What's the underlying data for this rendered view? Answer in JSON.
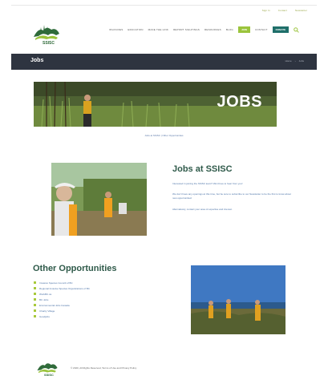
{
  "utility_links": [
    "Sign In",
    "Contact",
    "Newsletter"
  ],
  "brand": {
    "logo_text": "SSISC",
    "accent": "#9bc43c",
    "dark": "#2e3440",
    "teal": "#1f6f6a"
  },
  "nav": {
    "items": [
      "Invasives",
      "Education",
      "Make the Link",
      "Report Sightings",
      "Resources",
      "Blog"
    ],
    "join_label": "Join",
    "contact_label": "Contact",
    "donate_label": "Donate"
  },
  "titlebar": {
    "title": "Jobs",
    "crumb_home": "Home",
    "crumb_sep": "›",
    "crumb_current": "Jobs"
  },
  "hero": {
    "text": "JOBS"
  },
  "sublinks": "Jobs at SSISC  |  Other Opportunities",
  "jobs": {
    "heading": "Jobs at SSISC",
    "p1": "Interested in joining the SSISC team? We'd love to hear from you!",
    "p2": "We don't have any openings at this time, but be sure to subscribe to our Newsletter to be the first to know about new opportunities!",
    "p3": "Alternatively, contact your area of expertise and interest."
  },
  "other": {
    "heading": "Other Opportunities",
    "items": [
      "Invasive Species Council of BC",
      "Regional Invasive Species Organizations of BC",
      "WorkBC.ca",
      "BC Jobs",
      "Environmental Jobs Canada",
      "Charity Village",
      "Goodjobs"
    ]
  },
  "footer": {
    "copyright": "© 2020, All Rights Reserved, Terms of Use and Privacy Policy"
  }
}
